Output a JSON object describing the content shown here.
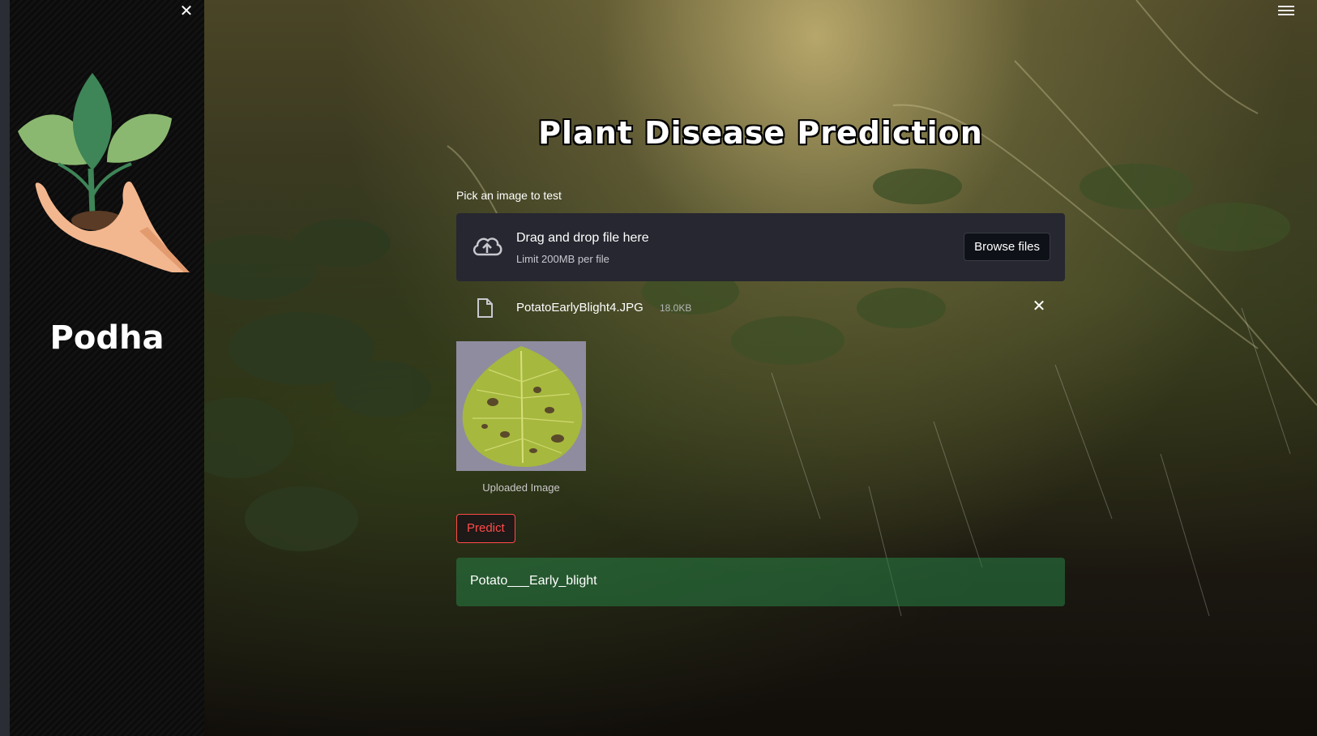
{
  "sidebar": {
    "close_icon": "close-icon",
    "brand_name": "Podha"
  },
  "header": {
    "menu_icon": "hamburger-menu-icon"
  },
  "main": {
    "title": "Plant Disease Prediction",
    "uploader": {
      "label": "Pick an image to test",
      "drag_text": "Drag and drop file here",
      "limit_text": "Limit 200MB per file",
      "browse_label": "Browse files",
      "icon": "cloud-upload-icon"
    },
    "file": {
      "name": "PotatoEarlyBlight4.JPG",
      "size": "18.0KB",
      "icon": "file-icon",
      "remove_icon": "close-icon"
    },
    "image": {
      "caption": "Uploaded Image"
    },
    "predict_label": "Predict",
    "result": "Potato___Early_blight"
  },
  "colors": {
    "sidebar_bg": "#0b0b0b",
    "dropzone_bg": "#262730",
    "accent_red": "#ff4b4b",
    "result_green": "#2e8046"
  }
}
